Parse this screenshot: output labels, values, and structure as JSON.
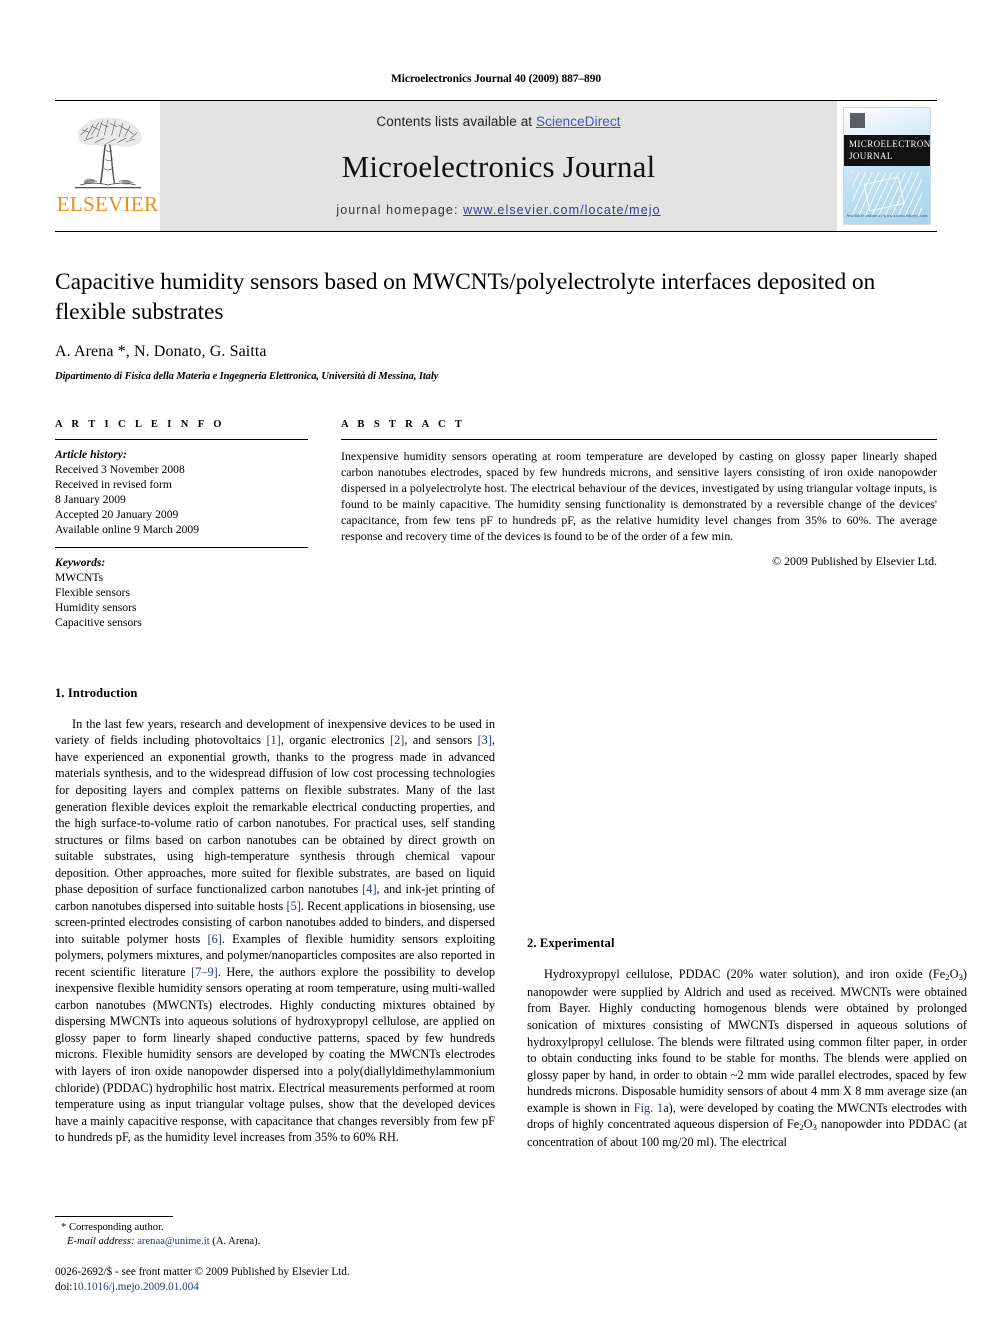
{
  "running_head": "Microelectronics Journal 40 (2009) 887–890",
  "masthead": {
    "publisher_name": "ELSEVIER",
    "contents_text": "Contents lists available at ",
    "contents_link": "ScienceDirect",
    "journal_title": "Microelectronics Journal",
    "homepage_label": "journal homepage: ",
    "homepage_link": "www.elsevier.com/locate/mejo",
    "cover_title_line1": "MICROELECTRONICS",
    "cover_title_line2": "JOURNAL",
    "cover_footer": "Available online at www.sciencedirect.com",
    "accent_orange": "#f08c1b",
    "link_blue": "#3b5ca8",
    "banner_grey": "#e3e3e3"
  },
  "title": "Capacitive humidity sensors based on MWCNTs/polyelectrolyte interfaces deposited on flexible substrates",
  "authors": "A. Arena *, N. Donato, G. Saitta",
  "affiliation": "Dipartimento di Fisica della Materia e Ingegneria Elettronica, Università di Messina, Italy",
  "article_info": {
    "heading": "A R T I C L E   I N F O",
    "history_label": "Article history:",
    "history": [
      "Received 3 November 2008",
      "Received in revised form",
      "8 January 2009",
      "Accepted 20 January 2009",
      "Available online 9 March 2009"
    ],
    "keywords_label": "Keywords:",
    "keywords": [
      "MWCNTs",
      "Flexible sensors",
      "Humidity sensors",
      "Capacitive sensors"
    ]
  },
  "abstract": {
    "heading": "A B S T R A C T",
    "text": "Inexpensive humidity sensors operating at room temperature are developed by casting on glossy paper linearly shaped carbon nanotubes electrodes, spaced by few hundreds microns, and sensitive layers consisting of iron oxide nanopowder dispersed in a polyelectrolyte host. The electrical behaviour of the devices, investigated by using triangular voltage inputs, is found to be mainly capacitive. The humidity sensing functionality is demonstrated by a reversible change of the devices' capacitance, from few tens pF to hundreds pF, as the relative humidity level changes from 35% to 60%. The average response and recovery time of the devices is found to be of the order of a few min.",
    "copyright": "© 2009 Published by Elsevier Ltd."
  },
  "sections": {
    "introduction": {
      "heading": "1.  Introduction",
      "p1_a": "In the last few years, research and development of inexpensive devices to be used in variety of fields including photovoltaics ",
      "p1_ref1": "[1]",
      "p1_b": ", organic electronics ",
      "p1_ref2": "[2]",
      "p1_c": ", and sensors ",
      "p1_ref3": "[3]",
      "p1_d": ", have experienced an exponential growth, thanks to the progress made in advanced materials synthesis, and to the widespread diffusion of low cost processing technologies for depositing layers and complex patterns on flexible substrates. Many of the last generation flexible devices exploit the remarkable electrical conducting properties, and the high surface-to-volume ratio of carbon nanotubes. For practical uses, self standing structures or films based on carbon nanotubes can be obtained by direct growth on suitable substrates, using high-temperature synthesis through chemical vapour deposition. Other approaches, more suited for flexible substrates, are based on liquid phase deposition of surface functionalized carbon nanotubes ",
      "p1_ref4": "[4]",
      "p1_e": ", and ink-jet printing of carbon nanotubes dispersed into suitable hosts ",
      "p1_ref5": "[5]",
      "p1_f": ". Recent applications in biosensing, use screen-printed electrodes consisting of carbon nanotubes added to binders, and dispersed into suitable polymer hosts ",
      "p1_ref6": "[6]",
      "p1_g": ". Examples of flexible humidity sensors exploiting polymers, polymers mixtures, and polymer/nanoparticles composites are also reported in recent scientific literature ",
      "p1_ref79": "[7–9]",
      "p1_h": ". Here, the authors explore the possibility to develop inexpensive flexible humidity sensors operating at room temperature, using multi-walled carbon nanotubes (MWCNTs) electrodes. Highly conducting mixtures obtained by dispersing MWCNTs into aqueous solutions of hydroxypropyl cellulose, are applied on glossy paper to form linearly shaped conductive patterns, spaced by few hundreds microns. Flexible humidity sensors are developed by coating the MWCNTs electrodes with layers of iron oxide nanopowder dispersed into a poly(diallyldimethylammonium chloride) (PDDAC) hydrophilic host matrix. Electrical measurements performed at room temperature using as input triangular voltage pulses, show that the developed devices have a mainly capacitive response, with capacitance that changes reversibly from few pF to hundreds pF, as the humidity level increases from 35% to 60% RH."
    },
    "experimental": {
      "heading": "2.  Experimental",
      "p1_a": "Hydroxypropyl cellulose, PDDAC (20% water solution), and iron oxide (Fe",
      "p1_sub1": "2",
      "p1_b": "O",
      "p1_sub2": "3",
      "p1_c": ") nanopowder were supplied by Aldrich and used as received. MWCNTs were obtained from Bayer. Highly conducting homogenous blends were obtained by prolonged sonication of mixtures consisting of MWCNTs dispersed in aqueous solutions of hydroxylpropyl cellulose. The blends were filtrated using common filter paper, in order to obtain conducting inks found to be stable for months. The blends were applied on glossy paper by hand, in order to obtain ~2 mm wide parallel electrodes, spaced by few hundreds microns. Disposable humidity sensors of about 4 mm X 8 mm average size (an example is shown in ",
      "p1_figref": "Fig. 1",
      "p1_d": "a), were developed by coating the MWCNTs electrodes with drops of highly concentrated aqueous dispersion of Fe",
      "p1_sub3": "2",
      "p1_e": "O",
      "p1_sub4": "3",
      "p1_f": " nanopowder into PDDAC (at concentration of about 100 mg/20 ml). The electrical"
    }
  },
  "footnote": {
    "corresponding": "* Corresponding author.",
    "email_label": "E-mail address:",
    "email": "arenaa@unime.it",
    "email_author": "(A. Arena).",
    "imprint": "0026-2692/$ - see front matter © 2009 Published by Elsevier Ltd.",
    "doi_label": "doi:",
    "doi": "10.1016/j.mejo.2009.01.004"
  }
}
